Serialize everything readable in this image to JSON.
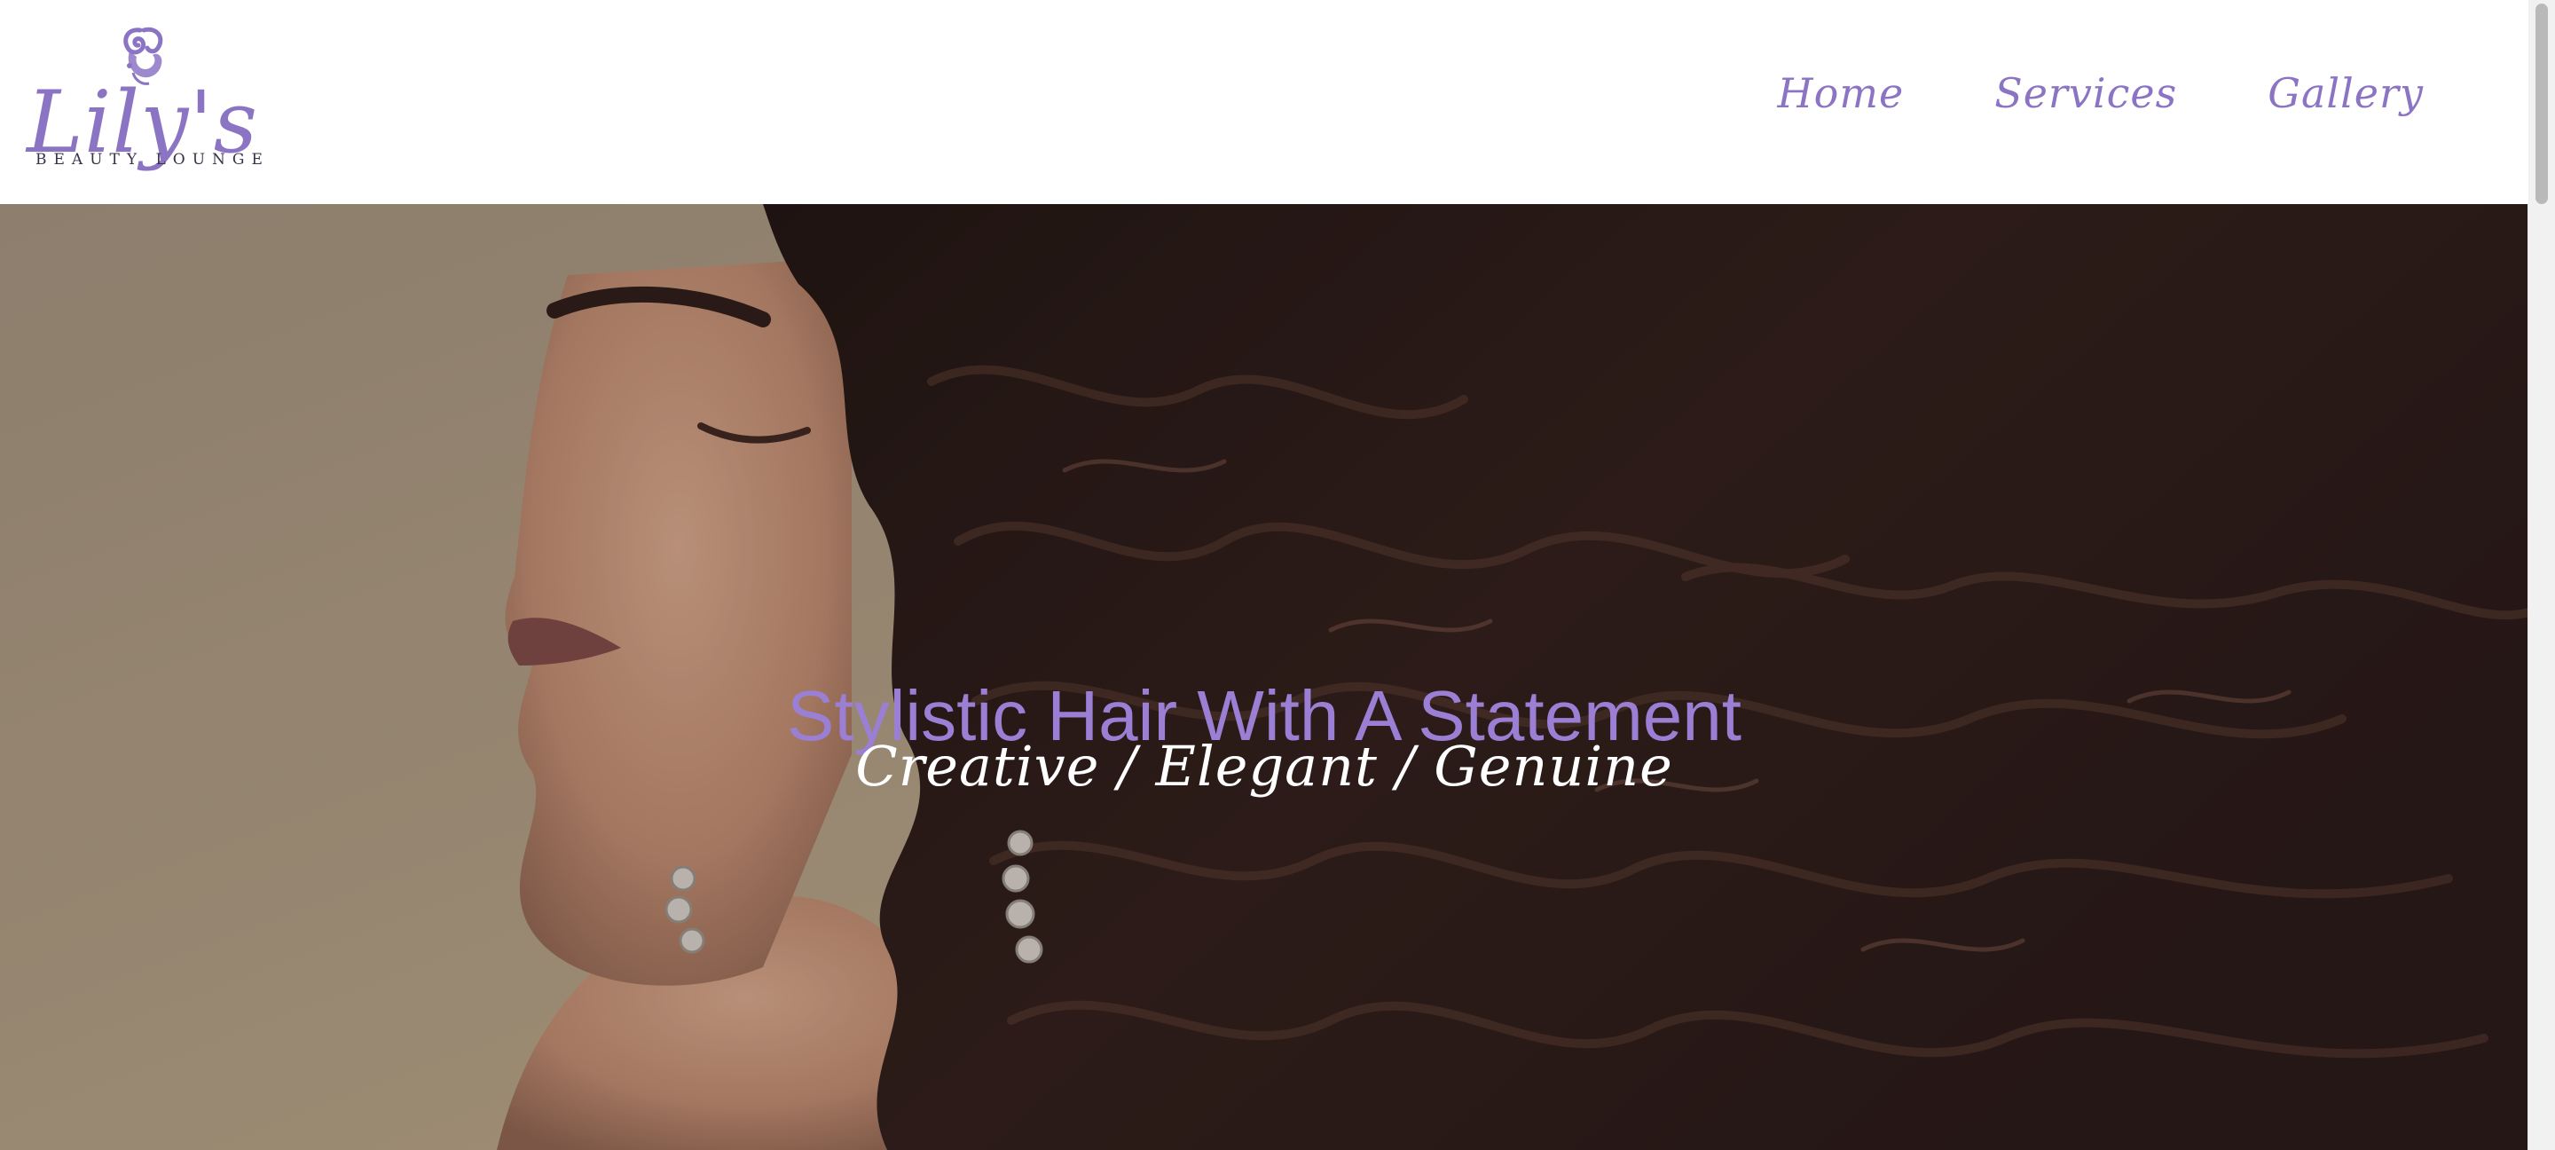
{
  "brand": {
    "name": "Lily's",
    "tagline": "BEAUTY LOUNGE",
    "logo_icon": "woman-silhouette-logo",
    "accent_color": "#8c74c4"
  },
  "nav": {
    "items": [
      {
        "label": "Home"
      },
      {
        "label": "Services"
      },
      {
        "label": "Gallery"
      }
    ]
  },
  "hero": {
    "title": "Stylistic Hair With A Statement",
    "subtitle": "Creative / Elegant / Genuine",
    "title_color": "#9b7fd4",
    "subtitle_color": "#ffffff",
    "image": "woman-with-long-wavy-hair"
  }
}
